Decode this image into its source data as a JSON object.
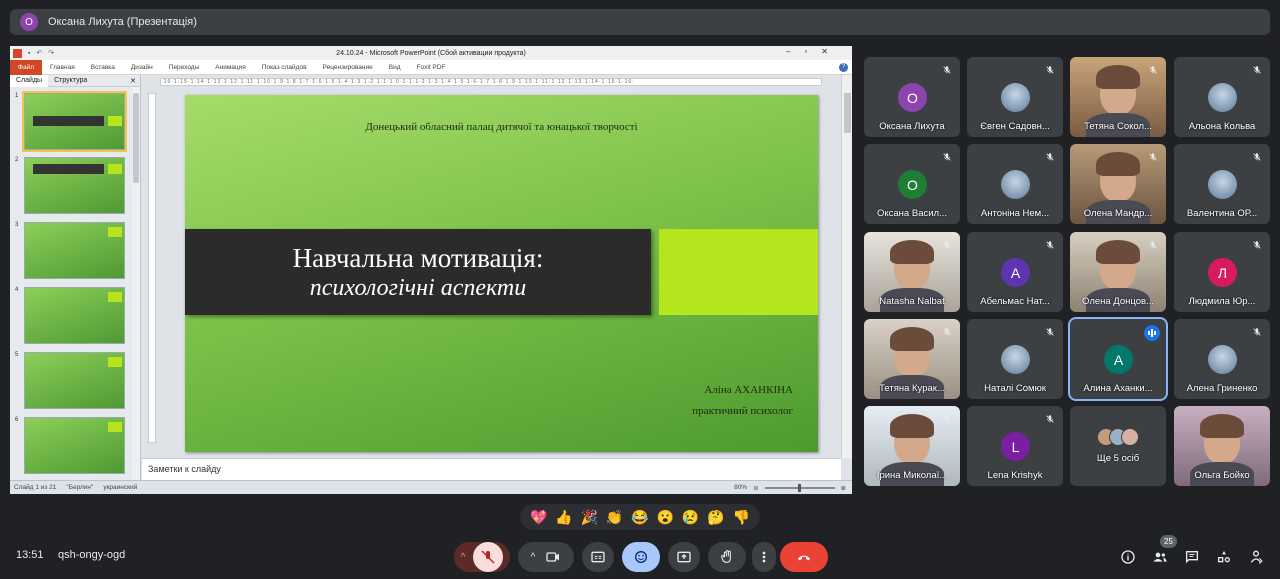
{
  "banner": {
    "initial": "О",
    "text": "Оксана Лихута (Презентація)"
  },
  "ppt": {
    "window_title": "24.10.24 - Microsoft PowerPoint (Сбой активации продукта)",
    "menu": [
      "Файл",
      "Главная",
      "Вставка",
      "Дизайн",
      "Переходы",
      "Анимация",
      "Показ слайдов",
      "Рецензирование",
      "Вид",
      "Foxit PDF"
    ],
    "pane_tabs": [
      "Слайды",
      "Структура"
    ],
    "thumbnail_numbers": [
      "1",
      "2",
      "3",
      "4",
      "5",
      "6"
    ],
    "ruler_text": "·16·1·15·1·14·1·13·1·12·1·11·1·10·1·9·1·8·1·7·1·6·1·5·1·4·1·3·1·2·1·1·1·0·1·1·1·2·1·3·1·4·1·5·1·6·1·7·1·8·1·9·1·10·1·11·1·12·1·13·1·14·1·15·1·16·",
    "slide": {
      "org": "Донецький обласний палац дитячої та юнацької творчості",
      "title_line1": "Навчальна мотивація:",
      "title_line2": "психологічні аспекти",
      "author": "Аліна  АХАНКІНА",
      "role": "практичний  психолог"
    },
    "notes_placeholder": "Заметки к слайду",
    "status": {
      "slide": "Слайд 1 из 21",
      "theme": "\"Берлин\"",
      "language": "украинский",
      "zoom": "80%"
    }
  },
  "participants": [
    {
      "name": "Оксана Лихута",
      "initial": "О",
      "color": "#8e44ad",
      "type": "avatar",
      "muted": true
    },
    {
      "name": "Євген Садовн...",
      "initial": "",
      "color": "#3c4043",
      "type": "photo-icon",
      "muted": true
    },
    {
      "name": "Тетяна Сокол...",
      "initial": "",
      "color": "",
      "type": "video",
      "muted": true
    },
    {
      "name": "Альона Кольва",
      "initial": "",
      "color": "#3c4043",
      "type": "photo-icon",
      "muted": true
    },
    {
      "name": "Оксана Васил...",
      "initial": "О",
      "color": "#1e7e34",
      "type": "avatar",
      "muted": true
    },
    {
      "name": "Антоніна Нем...",
      "initial": "",
      "color": "#3c4043",
      "type": "photo-icon",
      "muted": true
    },
    {
      "name": "Олена Мандр...",
      "initial": "",
      "color": "",
      "type": "video",
      "muted": true
    },
    {
      "name": "Валентина ОР...",
      "initial": "",
      "color": "#3c4043",
      "type": "photo-icon",
      "muted": true
    },
    {
      "name": "Natasha Nalbat",
      "initial": "",
      "color": "",
      "type": "video",
      "muted": true
    },
    {
      "name": "Абельмас Нат...",
      "initial": "А",
      "color": "#5e35b1",
      "type": "avatar",
      "muted": true
    },
    {
      "name": "Олена Донцов...",
      "initial": "",
      "color": "",
      "type": "video",
      "muted": true
    },
    {
      "name": "Людмила Юр...",
      "initial": "Л",
      "color": "#d81b60",
      "type": "avatar",
      "muted": true
    },
    {
      "name": "Тетяна Курак...",
      "initial": "",
      "color": "",
      "type": "video",
      "muted": true
    },
    {
      "name": "Наталі Сомюк",
      "initial": "",
      "color": "#3c4043",
      "type": "photo-icon",
      "muted": true
    },
    {
      "name": "Алина Аханки...",
      "initial": "А",
      "color": "#00796b",
      "type": "avatar",
      "muted": false,
      "speaking": true
    },
    {
      "name": "Алена Гриненко",
      "initial": "",
      "color": "#3c4043",
      "type": "photo-icon",
      "muted": true
    },
    {
      "name": "Ірина Миколаї...",
      "initial": "",
      "color": "",
      "type": "video",
      "muted": true
    },
    {
      "name": "Lena Krishyk",
      "initial": "L",
      "color": "#7b1fa2",
      "type": "avatar",
      "muted": true
    },
    {
      "name": "Ще 5 осіб",
      "initial": "",
      "color": "#3c4043",
      "type": "more",
      "muted": false
    },
    {
      "name": "Ольга Бойко",
      "initial": "",
      "color": "",
      "type": "video",
      "muted": false
    }
  ],
  "reactions": [
    "💖",
    "👍",
    "🎉",
    "👏",
    "😂",
    "😮",
    "😢",
    "🤔",
    "👎"
  ],
  "footer": {
    "time": "13:51",
    "meeting_code": "qsh-ongy-ogd",
    "participant_count": "25"
  },
  "colors": {
    "background": "#202124",
    "tile": "#3c4043",
    "accent": "#8ab4f8",
    "end_call": "#ea4335",
    "slide_lime": "#b5e61d"
  }
}
